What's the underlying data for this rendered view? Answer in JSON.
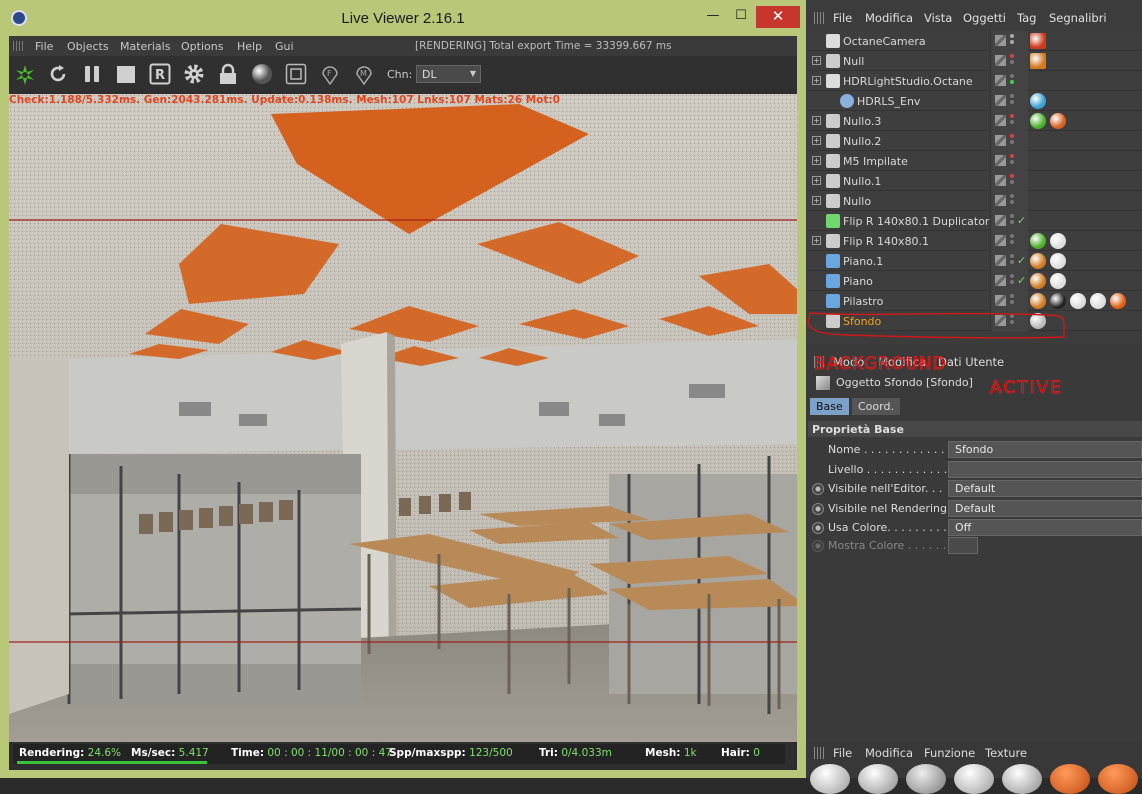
{
  "live_viewer": {
    "title": "Live Viewer 2.16.1",
    "controls": {
      "minimize": "—",
      "maximize": "☐",
      "close": "✕"
    },
    "menu": [
      "File",
      "Objects",
      "Materials",
      "Options",
      "Help",
      "Gui"
    ],
    "render_status": "[RENDERING] Total export Time = 33399.667 ms",
    "toolbar": {
      "icons": [
        "octane-logo-icon",
        "refresh-icon",
        "pause-icon",
        "stop-icon",
        "r-icon",
        "gear-icon",
        "lock-icon",
        "sphere-icon",
        "region-icon",
        "focus-picker-icon",
        "material-picker-icon"
      ],
      "channel_label": "Chn:",
      "channel_value": "DL"
    },
    "stats_line": "Check:1.188/5.332ms. Gen:2043.281ms. Update:0.138ms. Mesh:107 Lnks:107 Mats:26 Mot:0",
    "status": {
      "rendering_label": "Rendering:",
      "rendering_value": "24.6%",
      "ms_label": "Ms/sec:",
      "ms_value": "5.417",
      "time_label": "Time:",
      "time_value": "00 : 00 : 11/00 : 00 : 47",
      "spp_label": "Spp/maxspp:",
      "spp_value": "123/500",
      "tri_label": "Tri:",
      "tri_value": "0/4.033m",
      "mesh_label": "Mesh:",
      "mesh_value": "1k",
      "hair_label": "Hair:",
      "hair_value": "0",
      "progress": 0.246
    }
  },
  "object_manager": {
    "menu": [
      "File",
      "Modifica",
      "Vista",
      "Oggetti",
      "Tag",
      "Segnalibri"
    ],
    "objects": [
      {
        "name": "OctaneCamera",
        "expand": false,
        "indent": 0,
        "icon": "camera-icon"
      },
      {
        "name": "Null",
        "expand": true,
        "indent": 0,
        "icon": "null-icon"
      },
      {
        "name": "HDRLightStudio.Octane",
        "expand": true,
        "indent": 0,
        "icon": "hdr-icon"
      },
      {
        "name": "HDRLS_Env",
        "expand": false,
        "indent": 1,
        "icon": "sky-icon"
      },
      {
        "name": "Nullo.3",
        "expand": true,
        "indent": 0,
        "icon": "null-icon"
      },
      {
        "name": "Nullo.2",
        "expand": true,
        "indent": 0,
        "icon": "null-icon"
      },
      {
        "name": "M5 Impilate",
        "expand": true,
        "indent": 0,
        "icon": "null-icon"
      },
      {
        "name": "Nullo.1",
        "expand": true,
        "indent": 0,
        "icon": "null-icon"
      },
      {
        "name": "Nullo",
        "expand": true,
        "indent": 0,
        "icon": "null-icon"
      },
      {
        "name": "Flip R 140x80.1 Duplicatore",
        "expand": false,
        "indent": 0,
        "icon": "cloner-icon"
      },
      {
        "name": "Flip R 140x80.1",
        "expand": true,
        "indent": 0,
        "icon": "null-icon"
      },
      {
        "name": "Piano.1",
        "expand": false,
        "indent": 0,
        "icon": "plane-icon"
      },
      {
        "name": "Piano",
        "expand": false,
        "indent": 0,
        "icon": "plane-icon"
      },
      {
        "name": "Pilastro",
        "expand": false,
        "indent": 0,
        "icon": "polygon-icon"
      },
      {
        "name": "Sfondo",
        "expand": false,
        "indent": 0,
        "icon": "background-icon",
        "selected": true
      }
    ]
  },
  "annotation": {
    "line1": "BACKGROUND",
    "line2": "ACTIVE"
  },
  "attribute_manager": {
    "menu": [
      "Modo",
      "Modifica",
      "Dati Utente"
    ],
    "object_title": "Oggetto Sfondo [Sfondo]",
    "tabs": [
      "Base",
      "Coord."
    ],
    "section": "Proprietà Base",
    "props": [
      {
        "label": "Nome . . . . . . . . . . . . . .",
        "value": "Sfondo",
        "radio": false
      },
      {
        "label": "Livello . . . . . . . . . . . . .",
        "value": "",
        "radio": false
      },
      {
        "label": "Visibile nell'Editor. . .",
        "value": "Default",
        "radio": true
      },
      {
        "label": "Visibile nel Rendering",
        "value": "Default",
        "radio": true
      },
      {
        "label": "Usa Colore. . . . . . . . . .",
        "value": "Off",
        "radio": true
      },
      {
        "label": "Mostra Colore . . . . . .",
        "value": "",
        "radio": true,
        "disabled": true
      }
    ]
  },
  "material_manager": {
    "menu": [
      "File",
      "Modifica",
      "Funzione",
      "Texture"
    ]
  }
}
